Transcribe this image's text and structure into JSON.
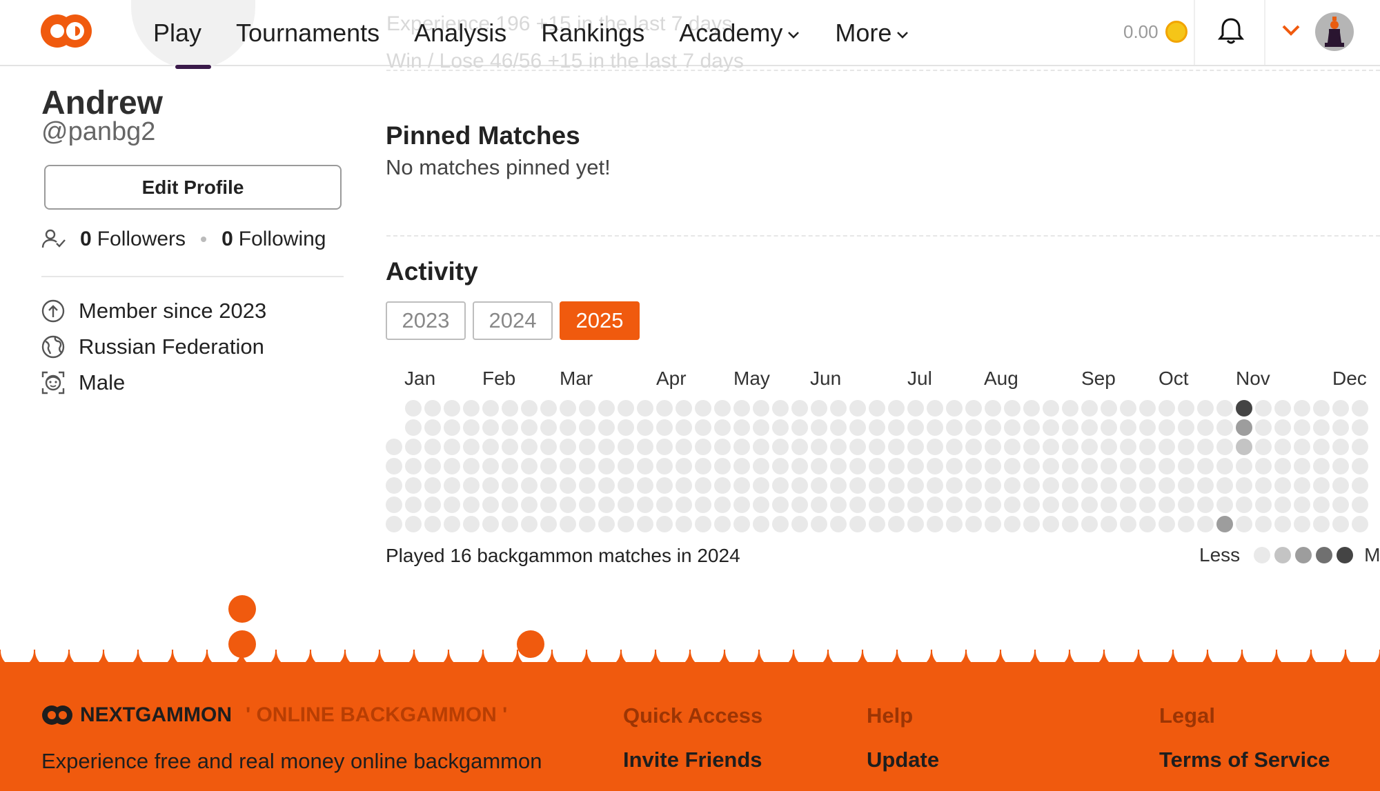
{
  "header": {
    "nav": [
      {
        "label": "Play",
        "dropdown": false
      },
      {
        "label": "Tournaments",
        "dropdown": false
      },
      {
        "label": "Analysis",
        "dropdown": false
      },
      {
        "label": "Rankings",
        "dropdown": false
      },
      {
        "label": "Academy",
        "dropdown": true
      },
      {
        "label": "More",
        "dropdown": true
      }
    ],
    "balance": "0.00",
    "ghost_line_1": "Experience  196   +15 in the last 7 days",
    "ghost_line_2": "Win / Lose   46/56   +15 in the last 7 days"
  },
  "profile": {
    "name": "Andrew",
    "handle": "@panbg2",
    "edit_label": "Edit Profile",
    "followers_count": "0",
    "followers_label": "Followers",
    "following_count": "0",
    "following_label": "Following",
    "member_since": "Member since 2023",
    "country": "Russian Federation",
    "gender": "Male"
  },
  "pinned": {
    "title": "Pinned Matches",
    "empty_text": "No matches pinned yet!"
  },
  "activity": {
    "title": "Activity",
    "years": [
      "2023",
      "2024",
      "2025"
    ],
    "active_year": "2025",
    "months": [
      "Jan",
      "Feb",
      "Mar",
      "Apr",
      "May",
      "Jun",
      "Jul",
      "Aug",
      "Sep",
      "Oct",
      "Nov",
      "Dec"
    ],
    "summary": "Played 16 backgammon matches in 2024",
    "legend_less": "Less",
    "legend_more": "M",
    "level_colors": [
      "#e9e9e9",
      "#c4c4c4",
      "#9d9d9d",
      "#707070",
      "#444444"
    ]
  },
  "footer": {
    "brand": "NEXTGAMMON",
    "tagline": "' ONLINE BACKGAMMON '",
    "description": "Experience free and real money online backgammon",
    "columns": [
      {
        "title": "Quick Access",
        "link": "Invite Friends"
      },
      {
        "title": "Help",
        "link": "Update"
      },
      {
        "title": "Legal",
        "link": "Terms of Service"
      }
    ]
  }
}
